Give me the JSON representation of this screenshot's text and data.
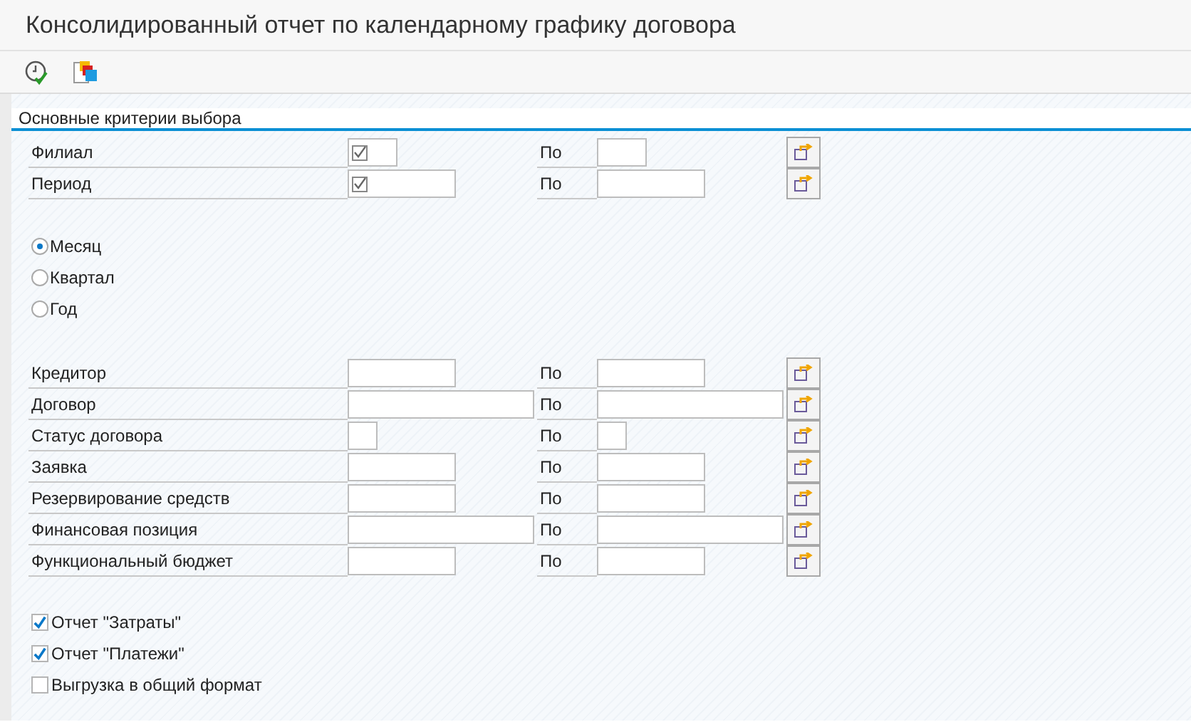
{
  "window": {
    "title": "Консолидированный отчет по календарному графику договора"
  },
  "toolbar": [
    {
      "kind": "execute"
    },
    {
      "kind": "variants"
    }
  ],
  "section": {
    "title": "Основные критерии выбора"
  },
  "ranges_top": [
    {
      "label": "Филиал",
      "required": true,
      "to_label": "По"
    },
    {
      "label": "Период",
      "required": true,
      "to_label": "По"
    }
  ],
  "period_options": [
    {
      "label": "Месяц",
      "selected": true
    },
    {
      "label": "Квартал",
      "selected": false
    },
    {
      "label": "Год",
      "selected": false
    }
  ],
  "ranges": [
    {
      "label": "Кредитор",
      "to_label": "По"
    },
    {
      "label": "Договор",
      "to_label": "По"
    },
    {
      "label": "Статус договора",
      "to_label": "По"
    },
    {
      "label": "Заявка",
      "to_label": "По"
    },
    {
      "label": "Резервирование средств",
      "to_label": "По"
    },
    {
      "label": "Финансовая позиция",
      "to_label": "По"
    },
    {
      "label": "Функциональный бюджет",
      "to_label": "По"
    }
  ],
  "options": [
    {
      "label": "Отчет \"Затраты\"",
      "checked": true
    },
    {
      "label": "Отчет \"Платежи\"",
      "checked": true
    },
    {
      "label": "Выгрузка в общий формат",
      "checked": false
    }
  ]
}
